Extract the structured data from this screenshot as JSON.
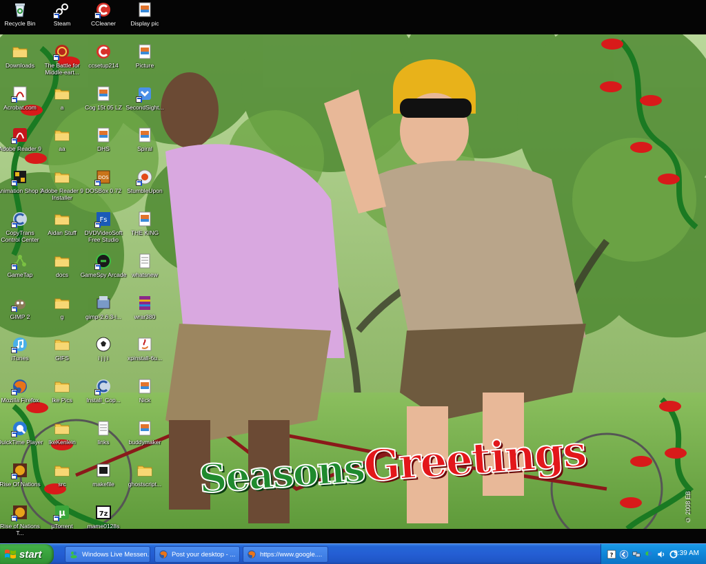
{
  "desktop": {
    "icons": [
      {
        "label": "Recycle Bin",
        "icon": "recycle-bin-icon"
      },
      {
        "label": "Steam",
        "icon": "steam-icon"
      },
      {
        "label": "CCleaner",
        "icon": "ccleaner-icon"
      },
      {
        "label": "Display pic",
        "icon": "image-file-icon"
      },
      {
        "label": "Downloads",
        "icon": "folder-icon"
      },
      {
        "label": "The Battle for Middle-eart...",
        "icon": "lotr-game-icon"
      },
      {
        "label": "ccsetup214",
        "icon": "installer-icon"
      },
      {
        "label": "Picture",
        "icon": "image-file-icon"
      },
      {
        "label": "Acrobat.com",
        "icon": "acrobat-com-icon"
      },
      {
        "label": "a",
        "icon": "folder-icon"
      },
      {
        "label": "Cog 15t 05 LZ",
        "icon": "image-file-icon"
      },
      {
        "label": "SecondSight...",
        "icon": "secondsight-icon"
      },
      {
        "label": "Adobe Reader 9",
        "icon": "adobe-reader-icon"
      },
      {
        "label": "aa",
        "icon": "folder-icon"
      },
      {
        "label": "DHS",
        "icon": "image-file-icon"
      },
      {
        "label": "Spiral",
        "icon": "image-file-icon"
      },
      {
        "label": "Animation Shop 3",
        "icon": "animation-shop-icon"
      },
      {
        "label": "Adobe Reader 9 Installer",
        "icon": "folder-icon"
      },
      {
        "label": "DOSBox 0.72",
        "icon": "dosbox-icon"
      },
      {
        "label": "StumbleUpon",
        "icon": "stumbleupon-icon"
      },
      {
        "label": "CopyTrans Control Center",
        "icon": "copytrans-icon"
      },
      {
        "label": "Aidan Stuff",
        "icon": "folder-icon"
      },
      {
        "label": "DVDVideoSoft Free Studio",
        "icon": "dvdvideosoft-icon"
      },
      {
        "label": "THE KING",
        "icon": "image-file-icon"
      },
      {
        "label": "GameTap",
        "icon": "gametap-icon"
      },
      {
        "label": "docs",
        "icon": "folder-icon"
      },
      {
        "label": "GameSpy Arcade",
        "icon": "gamespy-icon"
      },
      {
        "label": "whatsnew",
        "icon": "text-file-icon"
      },
      {
        "label": "GIMP 2",
        "icon": "gimp-icon"
      },
      {
        "label": "g",
        "icon": "folder-icon"
      },
      {
        "label": "gimp-2.6.3-i...",
        "icon": "gimp-installer-icon"
      },
      {
        "label": "wrar380",
        "icon": "winrar-icon"
      },
      {
        "label": "iTunes",
        "icon": "itunes-icon"
      },
      {
        "label": "GIFS",
        "icon": "folder-icon"
      },
      {
        "label": "i j j i",
        "icon": "soccer-ball-icon"
      },
      {
        "label": "xpinstall-6u...",
        "icon": "java-icon"
      },
      {
        "label": "Mozilla Firefox",
        "icon": "firefox-icon"
      },
      {
        "label": "Ike Pics",
        "icon": "folder-icon"
      },
      {
        "label": "Install_Cop...",
        "icon": "copytrans-icon"
      },
      {
        "label": "Nick",
        "icon": "image-file-icon"
      },
      {
        "label": "QuickTime Player",
        "icon": "quicktime-icon"
      },
      {
        "label": "IkeKenlein",
        "icon": "folder-icon"
      },
      {
        "label": "links",
        "icon": "text-file-icon"
      },
      {
        "label": "buddymaker",
        "icon": "image-file-icon"
      },
      {
        "label": "Rise Of Nations",
        "icon": "rise-of-nations-icon"
      },
      {
        "label": "src",
        "icon": "folder-icon"
      },
      {
        "label": "makefile",
        "icon": "makefile-icon"
      },
      {
        "label": "ghostscript...",
        "icon": "folder-icon"
      },
      {
        "label": "Rise of Nations T...",
        "icon": "rise-of-nations-icon"
      },
      {
        "label": "µTorrent",
        "icon": "utorrent-icon"
      },
      {
        "label": "mame0128s",
        "icon": "7zip-icon"
      }
    ]
  },
  "wallpaper": {
    "greeting_word1": "Seasons",
    "greeting_word2": "Greetings",
    "copyright": "© 2008 EB"
  },
  "taskbar": {
    "start_label": "start",
    "tasks": [
      {
        "label": "Windows Live Messen...",
        "icon": "messenger-icon"
      },
      {
        "label": "Post your desktop - ...",
        "icon": "firefox-icon"
      },
      {
        "label": "https://www.google....",
        "icon": "firefox-icon"
      }
    ],
    "tray": {
      "clock": "9:39 AM",
      "icons": [
        "help-icon",
        "chevron-left-icon",
        "network-icon",
        "msn-icon",
        "volume-icon",
        "sync-icon"
      ]
    }
  },
  "colors": {
    "taskbar_blue": "#245ed4",
    "start_green": "#3aa53f",
    "tray_blue": "#0f85d8",
    "greeting_green": "#1f8a2e",
    "greeting_red": "#e3171b"
  }
}
